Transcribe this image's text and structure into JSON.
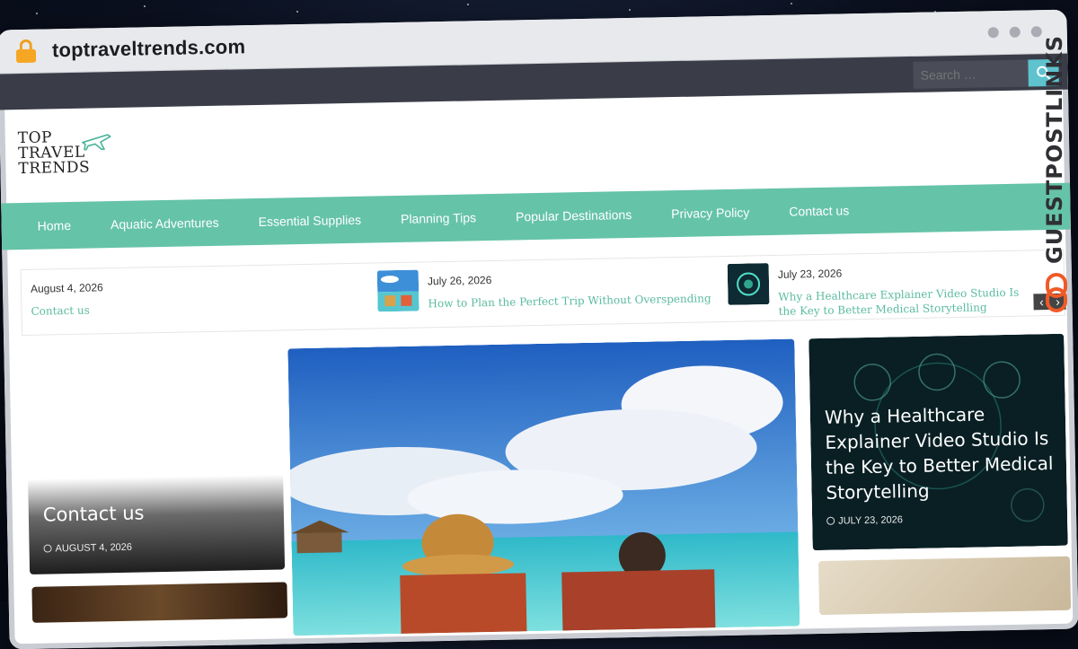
{
  "browser": {
    "url": "toptraveltrends.com"
  },
  "search": {
    "placeholder": "Search …"
  },
  "logo": {
    "line1": "TOP",
    "line2": "TRAVEL",
    "line3": "TRENDS"
  },
  "nav": {
    "items": [
      {
        "label": "Home"
      },
      {
        "label": "Aquatic Adventures"
      },
      {
        "label": "Essential Supplies"
      },
      {
        "label": "Planning Tips"
      },
      {
        "label": "Popular Destinations"
      },
      {
        "label": "Privacy Policy"
      },
      {
        "label": "Contact us"
      }
    ]
  },
  "ticker": {
    "items": [
      {
        "date": "August 4, 2026",
        "title": "Contact us"
      },
      {
        "date": "July 26, 2026",
        "title": "How to Plan the Perfect Trip Without Overspending"
      },
      {
        "date": "July 23, 2026",
        "title": "Why a Healthcare Explainer Video Studio Is the Key to Better Medical Storytelling"
      }
    ]
  },
  "cards": {
    "left": {
      "title": "Contact us",
      "date": "AUGUST 4, 2026"
    },
    "right": {
      "title": "Why a Healthcare Explainer Video Studio Is the Key to Better Medical Storytelling",
      "date": "JULY 23, 2026"
    }
  },
  "watermark": {
    "text": "GUESTPOSTLINKS"
  },
  "colors": {
    "nav_bg": "#65c3a8",
    "topbar_bg": "#3a3d48",
    "accent_text": "#5bbba0",
    "search_button": "#5ec3ce",
    "lock": "#f5a623"
  },
  "icons": [
    "lock-icon",
    "search-icon",
    "plane-icon",
    "clock-icon",
    "chevron-left-icon",
    "chevron-right-icon"
  ]
}
